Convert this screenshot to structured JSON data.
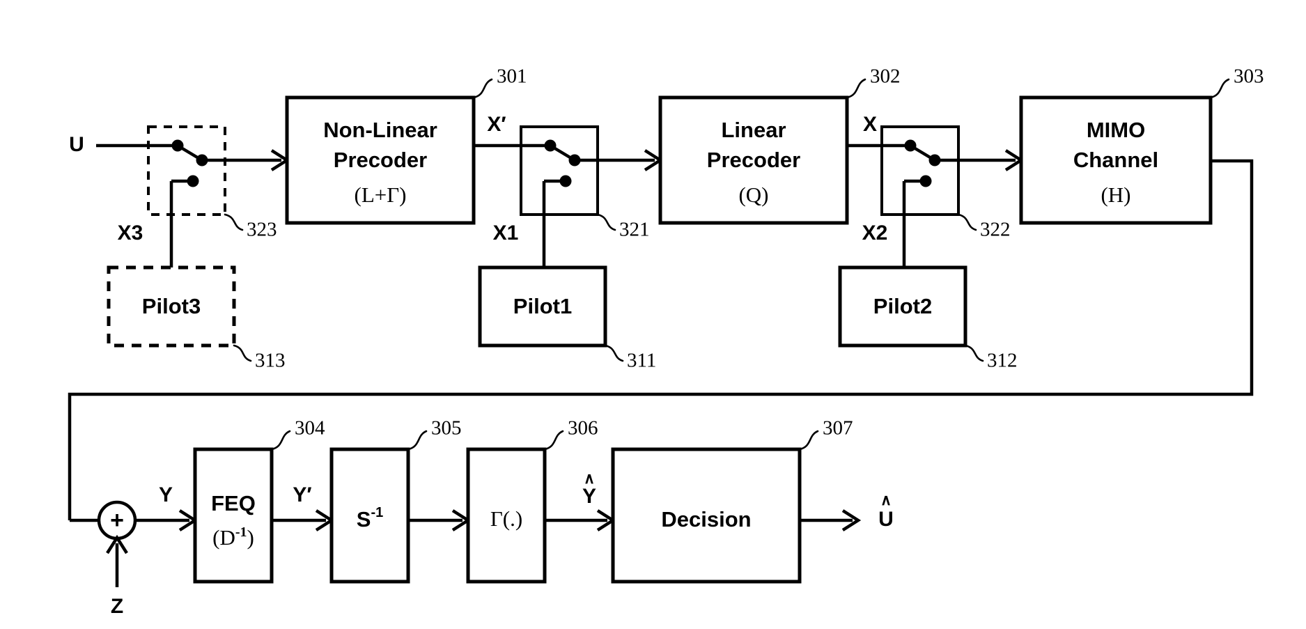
{
  "figure": {
    "type": "patent-block-diagram",
    "title": "MIMO non-linear precoding transmit/receive chain with pilot insertion switches"
  },
  "blocks": {
    "nonlinear_precoder": {
      "line1": "Non-Linear",
      "line2": "Precoder",
      "line3": "(L+Γ)",
      "ref": "301",
      "style": "solid"
    },
    "linear_precoder": {
      "line1": "Linear",
      "line2": "Precoder",
      "line3": "(Q)",
      "ref": "302",
      "style": "solid"
    },
    "mimo_channel": {
      "line1": "MIMO",
      "line2": "Channel",
      "line3": "(H)",
      "ref": "303",
      "style": "solid"
    },
    "feq": {
      "line1": "FEQ",
      "line2": "(D",
      "line2_sup": "-1",
      "line2_tail": ")",
      "ref": "304",
      "style": "solid"
    },
    "s_inverse": {
      "line1": "S",
      "line1_sup": "-1",
      "ref": "305",
      "style": "solid"
    },
    "gamma_fn": {
      "line1": "Γ(.)",
      "ref": "306",
      "style": "solid"
    },
    "decision": {
      "line1": "Decision",
      "ref": "307",
      "style": "solid"
    },
    "pilot1": {
      "line1": "Pilot1",
      "ref": "311",
      "style": "solid"
    },
    "pilot2": {
      "line1": "Pilot2",
      "ref": "312",
      "style": "solid"
    },
    "pilot3": {
      "line1": "Pilot3",
      "ref": "313",
      "style": "dashed"
    }
  },
  "switches": {
    "switch_323": {
      "ref": "323",
      "style": "dashed",
      "position": "upper-throw"
    },
    "switch_321": {
      "ref": "321",
      "style": "solid",
      "position": "upper-throw"
    },
    "switch_322": {
      "ref": "322",
      "style": "solid",
      "position": "upper-throw"
    }
  },
  "signals": {
    "u_in": "U",
    "x3": "X3",
    "x_prime": "X′",
    "x1": "X1",
    "x": "X",
    "x2": "X2",
    "y": "Y",
    "y_prime": "Y′",
    "y_hat_base": "Y",
    "y_hat_mark": "∧",
    "u_hat_base": "U",
    "u_hat_mark": "∧",
    "z_noise": "Z",
    "sum_symbol": "+"
  },
  "colors": {
    "line": "#000000",
    "background": "#ffffff",
    "text": "#000000"
  }
}
